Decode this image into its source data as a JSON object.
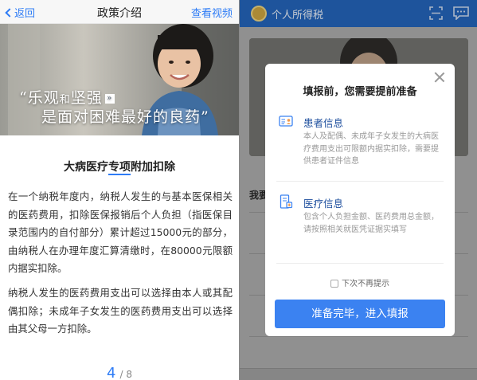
{
  "left": {
    "nav": {
      "back_label": "返回",
      "title": "政策介绍",
      "video_label": "查看视频"
    },
    "banner": {
      "line1_a": "“乐观",
      "line1_b": "和",
      "line1_c": "坚强",
      "arrow": "»",
      "line2": "是面对困难最好的良药”"
    },
    "section_title": "大病医疗专项附加扣除",
    "paragraph1": "在一个纳税年度内，纳税人发生的与基本医保相关的医药费用，扣除医保报销后个人负担（指医保目录范围内的自付部分）累计超过15000元的部分，由纳税人在办理年度汇算清缴时，在80000元限额内据实扣除。",
    "paragraph2": "纳税人发生的医药费用支出可以选择由本人或其配偶扣除；未成年子女发生的医药费用支出可以选择由其父母一方扣除。",
    "pager": {
      "current": "4",
      "total": "/ 8"
    }
  },
  "right": {
    "app_title": "个人所得税",
    "background_label": "我要",
    "modal": {
      "title": "填报前，您需要提前准备",
      "items": [
        {
          "icon": "patient-card-icon",
          "title": "患者信息",
          "desc": "本人及配偶、未成年子女发生的大病医疗费用支出可限额内据实扣除，需要提供患者证件信息"
        },
        {
          "icon": "medical-document-icon",
          "title": "医疗信息",
          "desc": "包含个人负担金额、医药费用总金额，请按照相关就医凭证据实填写"
        }
      ],
      "checkbox_label": "下次不再提示",
      "confirm_label": "准备完毕，进入填报"
    }
  },
  "colors": {
    "accent": "#2e7cf6",
    "app_bar": "#1d5fb6",
    "button": "#3b82f1",
    "item_title": "#1e4f9e"
  }
}
